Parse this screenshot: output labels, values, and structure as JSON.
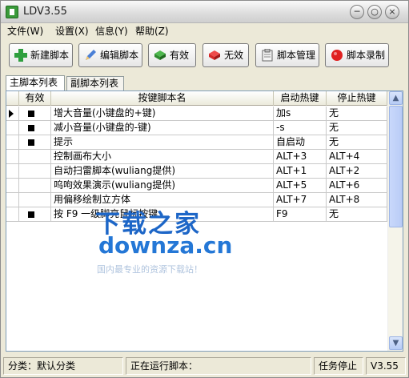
{
  "window": {
    "title": "LDV3.55"
  },
  "menu": [
    {
      "label": "文件(W)"
    },
    {
      "label": "设置(X)"
    },
    {
      "label": "信息(Y)"
    },
    {
      "label": "帮助(Z)"
    }
  ],
  "toolbar": {
    "new_script": "新建脚本",
    "edit_script": "编辑脚本",
    "enable": "有效",
    "disable": "无效",
    "manage_script": "脚本管理",
    "record_script": "脚本录制"
  },
  "tabs": [
    {
      "label": "主脚本列表",
      "active": true
    },
    {
      "label": "副脚本列表",
      "active": false
    }
  ],
  "table": {
    "columns": [
      "有效",
      "按键脚本名",
      "启动热键",
      "停止热键"
    ],
    "rows": [
      {
        "selected": true,
        "enabled": true,
        "name": "增大音量(小键盘的+键)",
        "start_key": "加s",
        "stop_key": "无"
      },
      {
        "selected": false,
        "enabled": true,
        "name": "减小音量(小键盘的-键)",
        "start_key": "-s",
        "stop_key": "无"
      },
      {
        "selected": false,
        "enabled": true,
        "name": "提示",
        "start_key": "自启动",
        "stop_key": "无"
      },
      {
        "selected": false,
        "enabled": false,
        "name": "控制画布大小",
        "start_key": "ALT+3",
        "stop_key": "ALT+4"
      },
      {
        "selected": false,
        "enabled": false,
        "name": "自动扫雷脚本(wuliang提供)",
        "start_key": "ALT+1",
        "stop_key": "ALT+2"
      },
      {
        "selected": false,
        "enabled": false,
        "name": "呜呴效果演示(wuliang提供)",
        "start_key": "ALT+5",
        "stop_key": "ALT+6"
      },
      {
        "selected": false,
        "enabled": false,
        "name": "用偏移绘制立方体",
        "start_key": "ALT+7",
        "stop_key": "ALT+8"
      },
      {
        "selected": false,
        "enabled": true,
        "name": "按 F9 一级脚亮鼠标按键",
        "start_key": "F9",
        "stop_key": "无"
      }
    ]
  },
  "watermark": {
    "title": "下载之家",
    "url": "downza.cn",
    "subtitle": "国内最专业的资源下载站！"
  },
  "statusbar": {
    "category": "分类：默认分类",
    "running": "正在运行脚本：",
    "task": "任务停止",
    "version": "V3.55"
  },
  "colors": {
    "toolbar_icon_new": "#2e9e3e",
    "toolbar_icon_edit": "#4a7fd6",
    "toolbar_icon_enable": "#2e8b2e",
    "toolbar_icon_disable": "#d62828",
    "toolbar_icon_record": "#e02020",
    "watermark": "#1d66c7"
  }
}
